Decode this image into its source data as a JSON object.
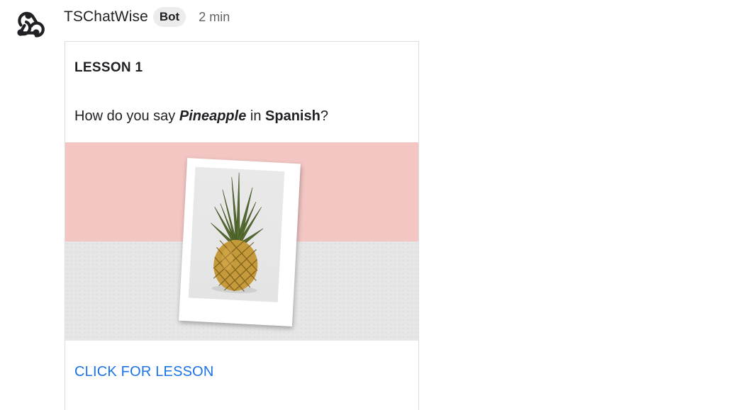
{
  "message": {
    "sender": "TSChatWise",
    "badge": "Bot",
    "time": "2 min"
  },
  "card": {
    "title": "LESSON 1",
    "question": {
      "prefix": "How do you say ",
      "word": "Pineapple",
      "middle": " in ",
      "language": "Spanish",
      "suffix": "?"
    },
    "cta_label": "CLICK FOR LESSON"
  },
  "colors": {
    "accent": "#1a73e8",
    "image_top": "#f3c6c3",
    "image_bottom": "#e6e6e6"
  },
  "icons": {
    "avatar": "webhook-icon"
  }
}
